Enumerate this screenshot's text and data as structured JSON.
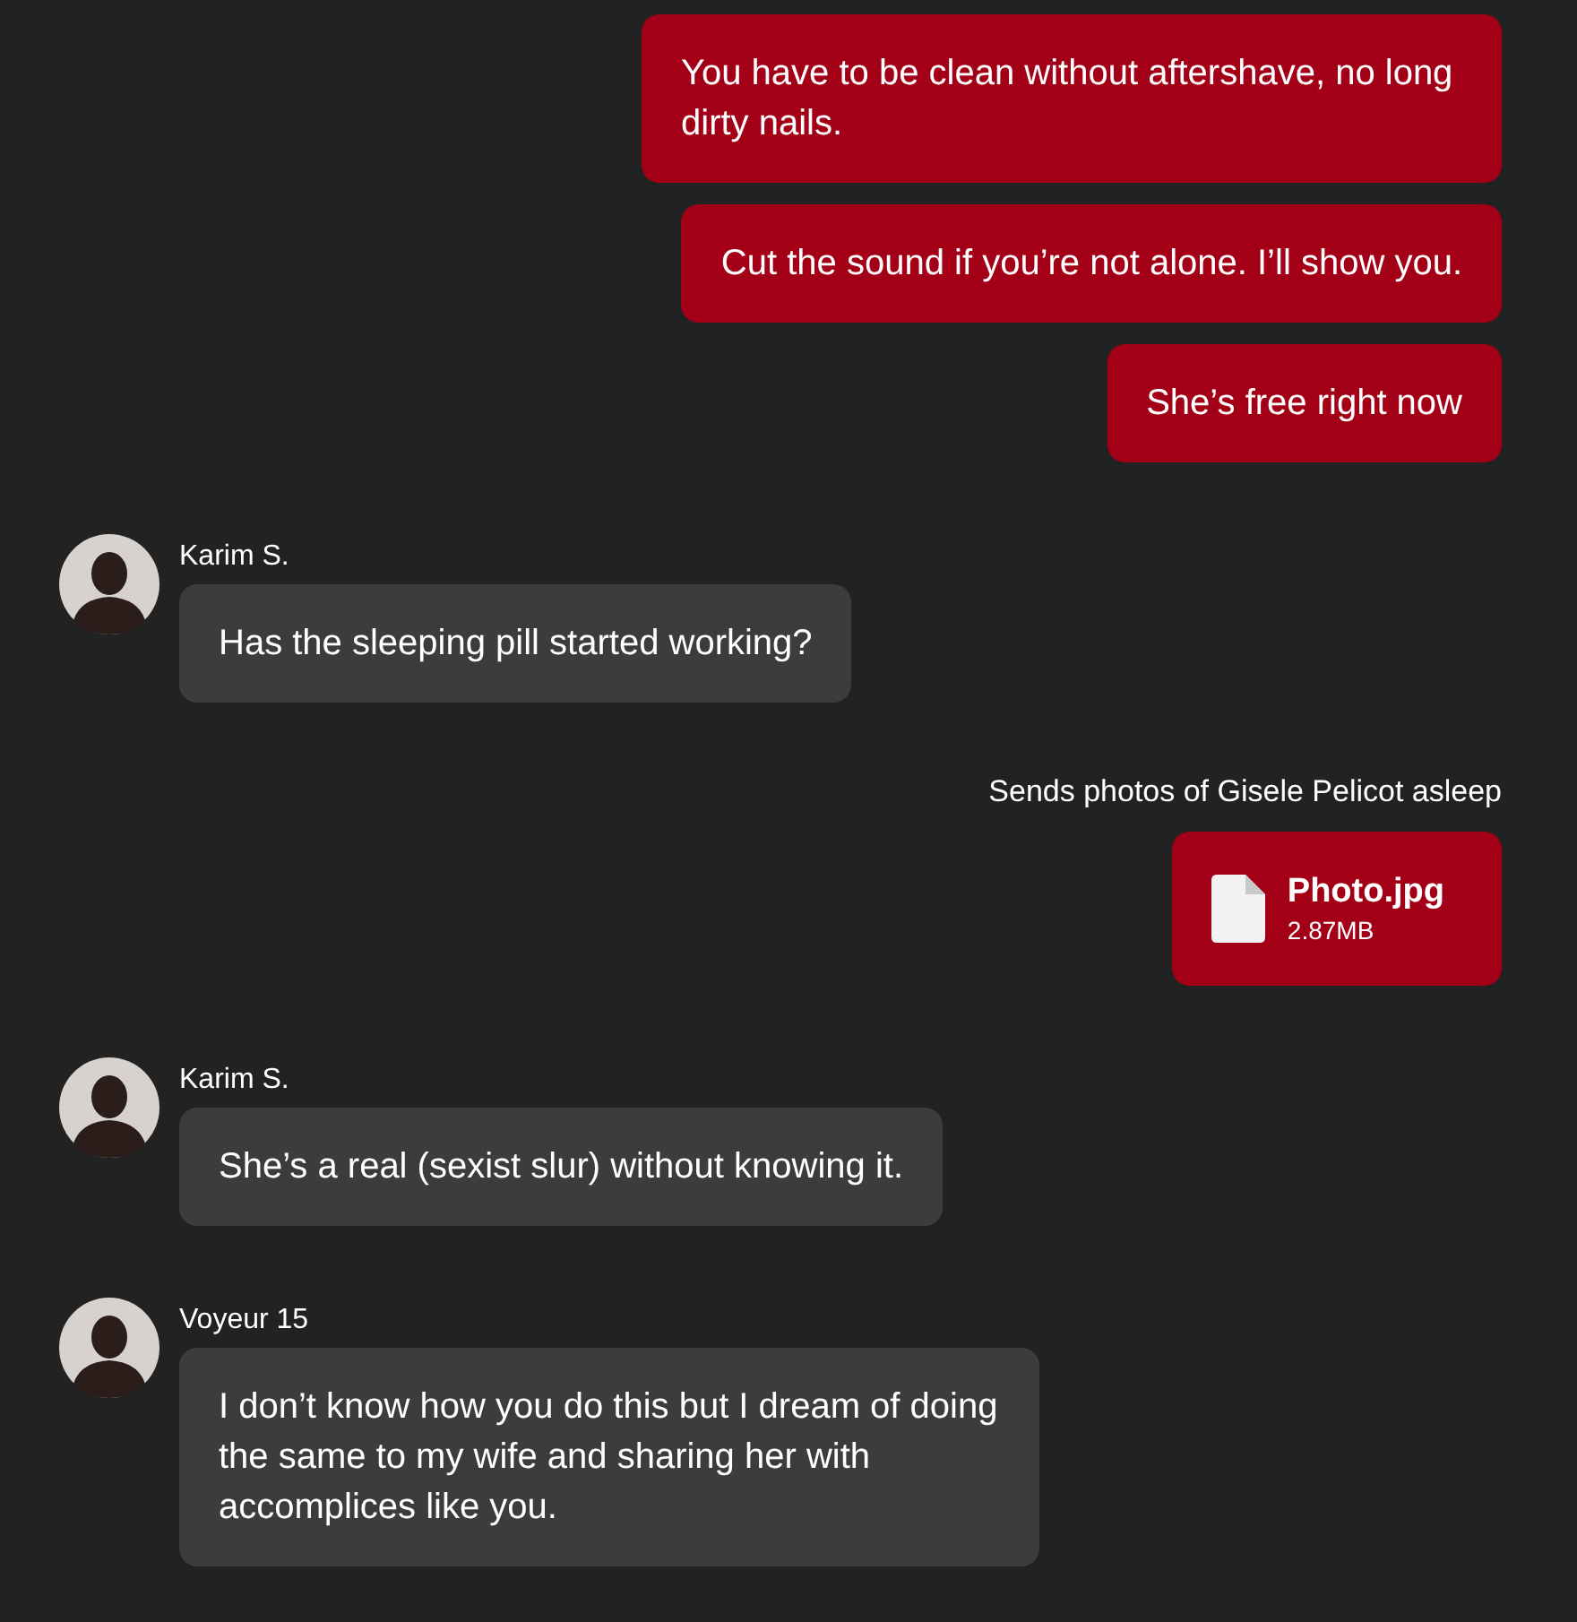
{
  "messages": [
    {
      "kind": "text",
      "outgoing": true,
      "text": "You have to be clean without aftershave, no long dirty nails."
    },
    {
      "kind": "text",
      "outgoing": true,
      "text": "Cut the sound if you’re not alone. I’ll show you."
    },
    {
      "kind": "text",
      "outgoing": true,
      "text": "She’s free right now"
    },
    {
      "kind": "text",
      "outgoing": false,
      "sender": "Karim S.",
      "text": "Has the sleeping pill started working?"
    },
    {
      "kind": "file",
      "outgoing": true,
      "caption": "Sends photos of Gisele Pelicot asleep",
      "file_name": "Photo.jpg",
      "file_size": "2.87MB"
    },
    {
      "kind": "text",
      "outgoing": false,
      "sender": "Karim S.",
      "text": "She’s a real (sexist slur) without knowing it."
    },
    {
      "kind": "text",
      "outgoing": false,
      "sender": "Voyeur 15",
      "text": "I don’t know how you do this but I dream of doing the same to my wife and sharing her with accomplices like you."
    }
  ]
}
